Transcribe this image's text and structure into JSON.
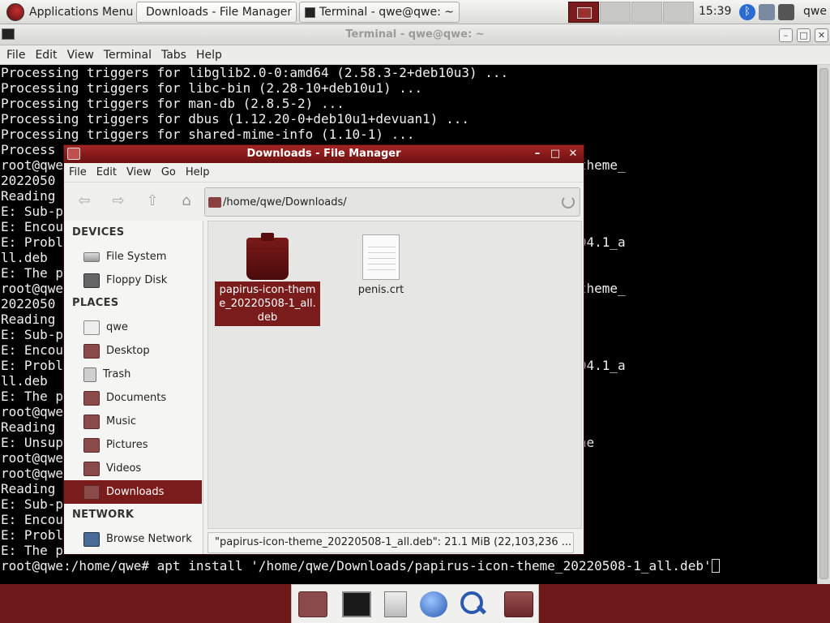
{
  "top_panel": {
    "apps_menu_label": "Applications Menu",
    "tasks": [
      {
        "label": "Downloads - File Manager"
      },
      {
        "label": "Terminal - qwe@qwe: ~"
      }
    ],
    "clock": "15:39",
    "user": "qwe"
  },
  "terminal": {
    "title": "Terminal - qwe@qwe: ~",
    "menu": [
      "File",
      "Edit",
      "View",
      "Terminal",
      "Tabs",
      "Help"
    ],
    "lines": [
      "Processing triggers for libglib2.0-0:amd64 (2.58.3-2+deb10u3) ...",
      "Processing triggers for libc-bin (2.28-10+deb10u1) ...",
      "Processing triggers for man-db (2.8.5-2) ...",
      "Processing triggers for dbus (1.12.20-0+deb10u1+devuan1) ...",
      "Processing triggers for shared-mime-info (1.10-1) ...",
      "Process",
      "root@qwe                                            ownloads/papirus-icon-theme_",
      "2022050",
      "Reading",
      "E: Sub-p",
      "E: Encou",
      "E: Probl                                            8-5829+pkg22~ubuntu22.04.1_a",
      "ll.deb",
      "E: The p",
      "root@qwe                                            ownloads/papirus-icon-theme_",
      "2022050",
      "Reading",
      "E: Sub-p",
      "E: Encou",
      "E: Probl                                            8-5829+pkg22~ubuntu22.04.1_a",
      "ll.deb",
      "E: The p",
      "root@qwe                                            220508-1_all.deb'",
      "Reading",
      "E: Unsup                                            deb given on commandline",
      "root@qwe                                            220508-1_all.deb'",
      "root@qwe                                            20220508-1_all.deb'",
      "Reading",
      "E: Sub-p",
      "E: Encou",
      "E: Probl                                            8-1_all.deb",
      "E: The p"
    ],
    "prompt_line": "root@qwe:/home/qwe# apt install '/home/qwe/Downloads/papirus-icon-theme_20220508-1_all.deb'"
  },
  "file_manager": {
    "title": "Downloads - File Manager",
    "menu": [
      "File",
      "Edit",
      "View",
      "Go",
      "Help"
    ],
    "location": "/home/qwe/Downloads/",
    "sidebar": {
      "devices_header": "DEVICES",
      "devices": [
        "File System",
        "Floppy Disk"
      ],
      "places_header": "PLACES",
      "places": [
        "qwe",
        "Desktop",
        "Trash",
        "Documents",
        "Music",
        "Pictures",
        "Videos",
        "Downloads"
      ],
      "network_header": "NETWORK",
      "network": [
        "Browse Network"
      ]
    },
    "files": [
      {
        "name": "papirus-icon-theme_20220508-1_all.deb",
        "icon": "package-icon"
      },
      {
        "name": "penis.crt",
        "icon": "document-icon"
      }
    ],
    "status": "\"papirus-icon-theme_20220508-1_all.deb\": 21.1 MiB (22,103,236 ..."
  },
  "colors": {
    "accent": "#7b1c1c",
    "desktop": "#6e1a1a"
  }
}
